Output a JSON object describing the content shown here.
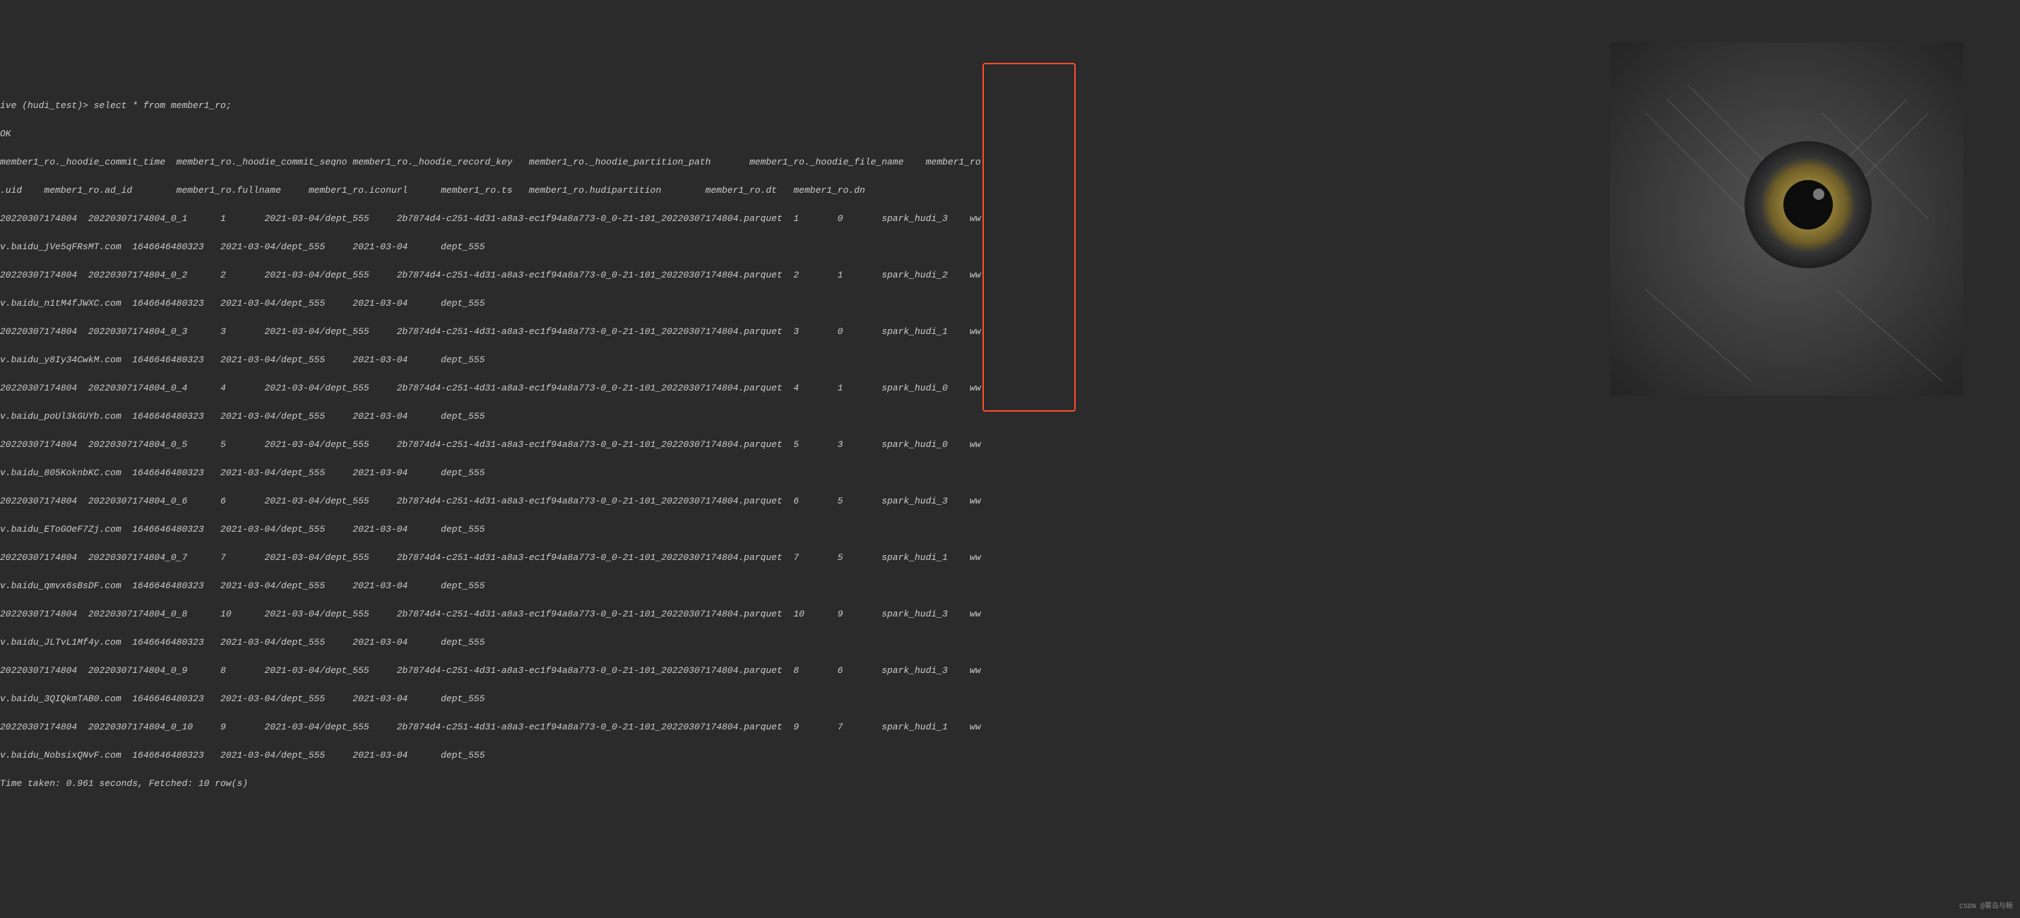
{
  "prompt": "ive (hudi_test)> select * from member1_ro;",
  "ok": "OK",
  "headers_line1": "member1_ro._hoodie_commit_time  member1_ro._hoodie_commit_seqno member1_ro._hoodie_record_key   member1_ro._hoodie_partition_path       member1_ro._hoodie_file_name    member1_ro",
  "headers_line2": ".uid    member1_ro.ad_id        member1_ro.fullname     member1_ro.iconurl      member1_ro.ts   member1_ro.hudipartition        member1_ro.dt   member1_ro.dn",
  "rows": [
    {
      "a": "20220307174804  20220307174804_0_1      1       2021-03-04/dept_555     2b7874d4-c251-4d31-a8a3-ec1f94a8a773-0_0-21-101_20220307174804.parquet  1       0       spark_hudi_3    ww",
      "b": "v.baidu_jVe5qFRsMT.com  1646646480323   2021-03-04/dept_555     2021-03-04      dept_555"
    },
    {
      "a": "20220307174804  20220307174804_0_2      2       2021-03-04/dept_555     2b7874d4-c251-4d31-a8a3-ec1f94a8a773-0_0-21-101_20220307174804.parquet  2       1       spark_hudi_2    ww",
      "b": "v.baidu_n1tM4fJWXC.com  1646646480323   2021-03-04/dept_555     2021-03-04      dept_555"
    },
    {
      "a": "20220307174804  20220307174804_0_3      3       2021-03-04/dept_555     2b7874d4-c251-4d31-a8a3-ec1f94a8a773-0_0-21-101_20220307174804.parquet  3       0       spark_hudi_1    ww",
      "b": "v.baidu_y8Iy34CwkM.com  1646646480323   2021-03-04/dept_555     2021-03-04      dept_555"
    },
    {
      "a": "20220307174804  20220307174804_0_4      4       2021-03-04/dept_555     2b7874d4-c251-4d31-a8a3-ec1f94a8a773-0_0-21-101_20220307174804.parquet  4       1       spark_hudi_0    ww",
      "b": "v.baidu_poUl3kGUYb.com  1646646480323   2021-03-04/dept_555     2021-03-04      dept_555"
    },
    {
      "a": "20220307174804  20220307174804_0_5      5       2021-03-04/dept_555     2b7874d4-c251-4d31-a8a3-ec1f94a8a773-0_0-21-101_20220307174804.parquet  5       3       spark_hudi_0    ww",
      "b": "v.baidu_805KoknbKC.com  1646646480323   2021-03-04/dept_555     2021-03-04      dept_555"
    },
    {
      "a": "20220307174804  20220307174804_0_6      6       2021-03-04/dept_555     2b7874d4-c251-4d31-a8a3-ec1f94a8a773-0_0-21-101_20220307174804.parquet  6       5       spark_hudi_3    ww",
      "b": "v.baidu_EToGOeF7Zj.com  1646646480323   2021-03-04/dept_555     2021-03-04      dept_555"
    },
    {
      "a": "20220307174804  20220307174804_0_7      7       2021-03-04/dept_555     2b7874d4-c251-4d31-a8a3-ec1f94a8a773-0_0-21-101_20220307174804.parquet  7       5       spark_hudi_1    ww",
      "b": "v.baidu_qmvx6sBsDF.com  1646646480323   2021-03-04/dept_555     2021-03-04      dept_555"
    },
    {
      "a": "20220307174804  20220307174804_0_8      10      2021-03-04/dept_555     2b7874d4-c251-4d31-a8a3-ec1f94a8a773-0_0-21-101_20220307174804.parquet  10      9       spark_hudi_3    ww",
      "b": "v.baidu_JLTvL1Mf4y.com  1646646480323   2021-03-04/dept_555     2021-03-04      dept_555"
    },
    {
      "a": "20220307174804  20220307174804_0_9      8       2021-03-04/dept_555     2b7874d4-c251-4d31-a8a3-ec1f94a8a773-0_0-21-101_20220307174804.parquet  8       6       spark_hudi_3    ww",
      "b": "v.baidu_3QIQkmTAB0.com  1646646480323   2021-03-04/dept_555     2021-03-04      dept_555"
    },
    {
      "a": "20220307174804  20220307174804_0_10     9       2021-03-04/dept_555     2b7874d4-c251-4d31-a8a3-ec1f94a8a773-0_0-21-101_20220307174804.parquet  9       7       spark_hudi_1    ww",
      "b": "v.baidu_NobsixQNvF.com  1646646480323   2021-03-04/dept_555     2021-03-04      dept_555"
    }
  ],
  "footer": "Time taken: 0.961 seconds, Fetched: 10 row(s)",
  "watermark": "CSDN @雾岛与鲸"
}
